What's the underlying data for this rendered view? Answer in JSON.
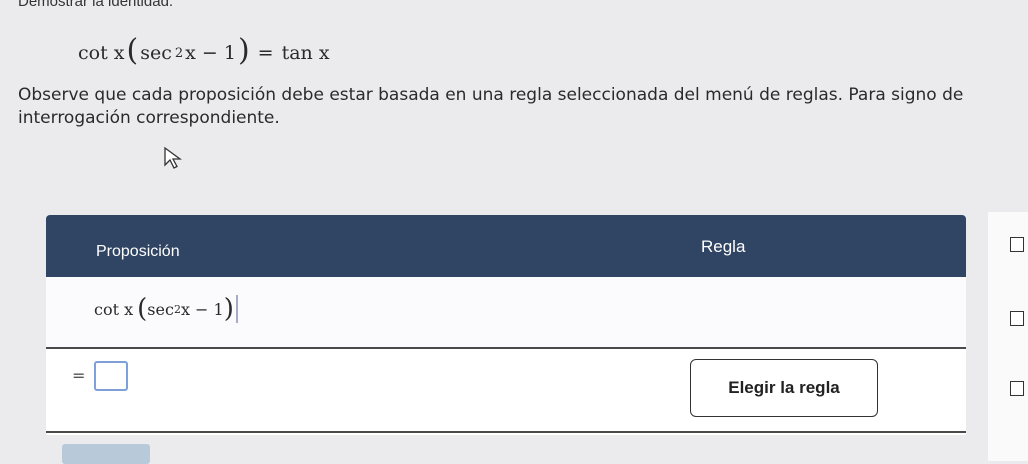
{
  "page": {
    "title": "Demostrar la identidad.",
    "identity": {
      "lhs_func": "cot x",
      "lhs_inner_a": "sec",
      "lhs_inner_exp": "2",
      "lhs_inner_b": "x − 1",
      "eq": "=",
      "rhs": "tan x"
    },
    "instructions": "Observe que cada proposición debe estar basada en una regla seleccionada del menú de reglas. Para signo de interrogación correspondiente."
  },
  "table": {
    "header_proposition": "Proposición",
    "header_rule": "Regla",
    "row1": {
      "func": "cot x",
      "inner_a": "sec",
      "inner_exp": "2",
      "inner_b": "x − 1"
    },
    "row2": {
      "eq": "=",
      "rule_button": "Elegir la regla"
    }
  },
  "icons": {
    "pointer": "mouse-pointer-icon",
    "checkbox": "checkbox-icon"
  },
  "colors": {
    "header_bg": "#2f4563",
    "answer_border": "#7da0d8"
  }
}
